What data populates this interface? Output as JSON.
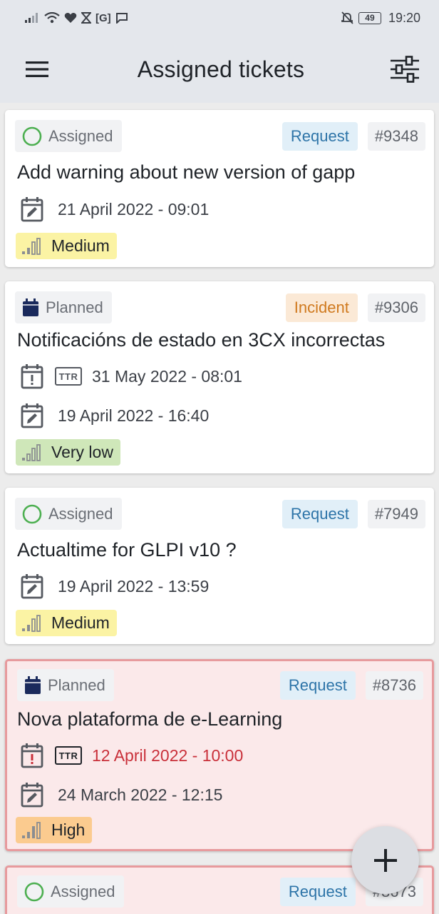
{
  "statusbar": {
    "battery": "49",
    "time": "19:20",
    "g_badge": "[G]"
  },
  "appbar": {
    "title": "Assigned tickets"
  },
  "tickets": [
    {
      "status": "Assigned",
      "type": "Request",
      "id": "#9348",
      "title": "Add warning about new version of gapp",
      "date": "21 April 2022 - 09:01",
      "priority": "Medium"
    },
    {
      "status": "Planned",
      "type": "Incident",
      "id": "#9306",
      "title": "Notificacións de estado en 3CX incorrectas",
      "ttr_label": "TTR",
      "ttr_date": "31 May 2022 - 08:01",
      "date": "19 April 2022 - 16:40",
      "priority": "Very low"
    },
    {
      "status": "Assigned",
      "type": "Request",
      "id": "#7949",
      "title": "Actualtime for GLPI v10 ?",
      "date": "19 April 2022 - 13:59",
      "priority": "Medium"
    },
    {
      "status": "Planned",
      "type": "Request",
      "id": "#8736",
      "title": "Nova plataforma de e-Learning",
      "ttr_label": "TTR",
      "ttr_date": "12 April 2022 - 10:00",
      "date": "24 March 2022 - 12:15",
      "priority": "High"
    },
    {
      "status": "Assigned",
      "type": "Request",
      "id": "#8673"
    }
  ],
  "colors": {
    "assigned_ring": "#4caf50",
    "planned_calendar": "#1a2a5c",
    "late_border": "#e79a9d",
    "late_text": "#c9303a"
  }
}
